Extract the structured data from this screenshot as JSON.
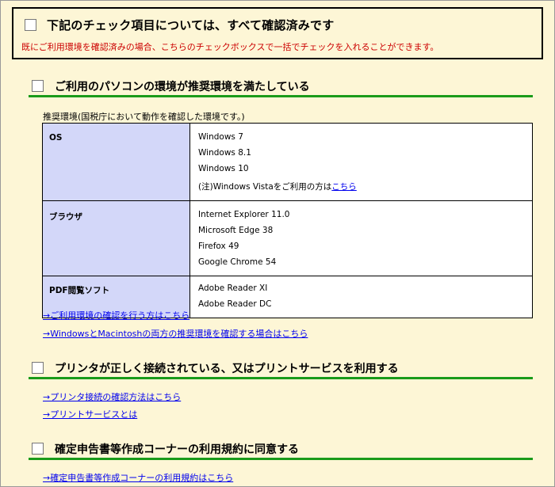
{
  "confirm_all": {
    "label": "下記のチェック項目については、すべて確認済みです",
    "note": "既にご利用環境を確認済みの場合、こちらのチェックボックスで一括でチェックを入れることができます。"
  },
  "sections": {
    "pc_env": {
      "label": "ご利用のパソコンの環境が推奨環境を満たしている",
      "caption": "推奨環境(国税庁において動作を確認した環境です。)",
      "table": {
        "os_head": "OS",
        "os_items": [
          "Windows 7",
          "Windows 8.1",
          "Windows 10"
        ],
        "os_note": "(注)Windows Vistaをご利用の方は",
        "os_note_link": "こちら",
        "browser_head": "ブラウザ",
        "browser_items": [
          "Internet Explorer 11.0",
          "Microsoft Edge 38",
          "Firefox 49",
          "Google Chrome 54"
        ],
        "pdf_head": "PDF閲覧ソフト",
        "pdf_items": [
          "Adobe Reader XI",
          "Adobe Reader DC"
        ]
      },
      "links": [
        "→ご利用環境の確認を行う方はこちら",
        "→WindowsとMacintoshの両方の推奨環境を確認する場合はこちら"
      ]
    },
    "printer": {
      "label": "プリンタが正しく接続されている、又はプリントサービスを利用する",
      "links": [
        "→プリンタ接続の確認方法はこちら",
        "→プリントサービスとは"
      ]
    },
    "terms": {
      "label": "確定申告書等作成コーナーの利用規約に同意する",
      "links": [
        "→確定申告書等作成コーナーの利用規約はこちら"
      ]
    }
  }
}
